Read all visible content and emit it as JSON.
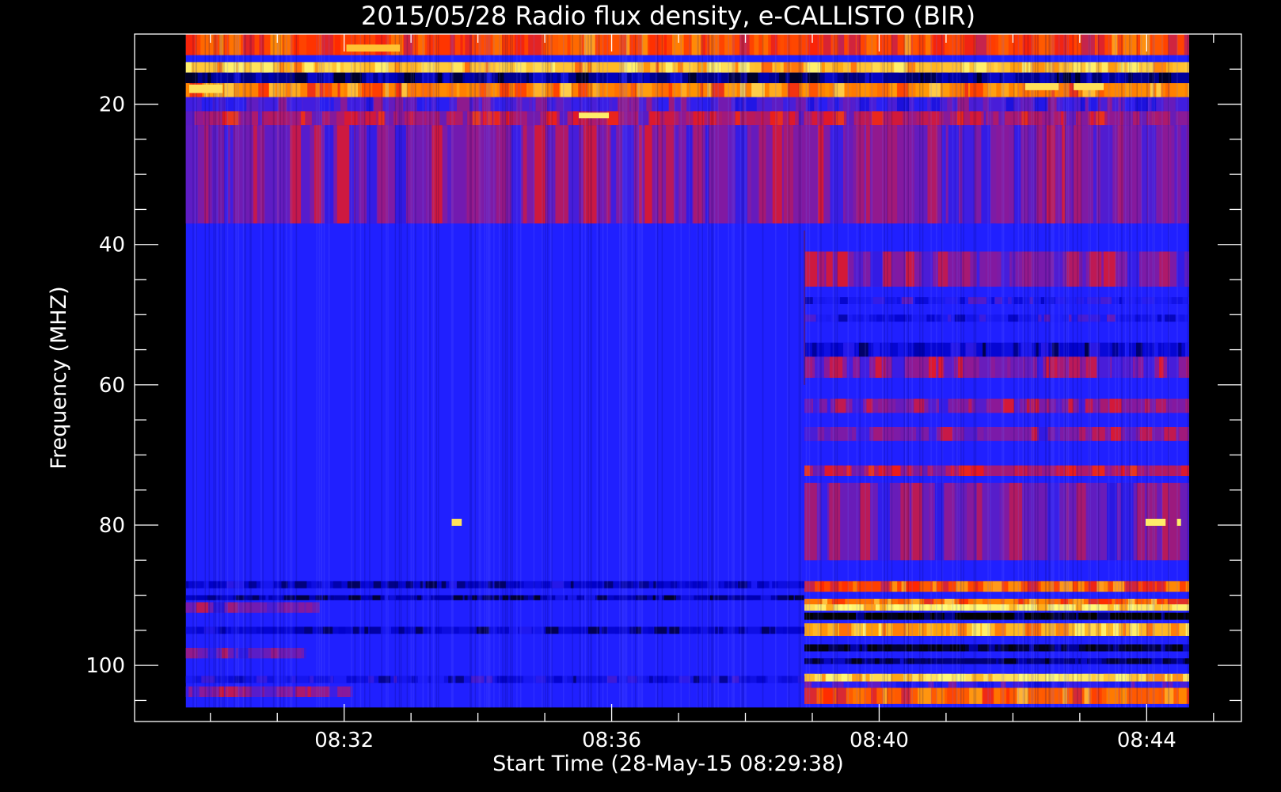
{
  "chart_data": {
    "type": "heatmap",
    "title": "2015/05/28  Radio flux density, e-CALLISTO (BIR)",
    "xlabel": "Start Time (28-May-15 08:29:38)",
    "ylabel": "Frequency (MHZ)",
    "x_tick_labels": [
      "08:32",
      "08:36",
      "08:40",
      "08:44"
    ],
    "x_tick_values_min": [
      2.3667,
      6.3667,
      10.3667,
      14.3667
    ],
    "x_range_min": [
      -0.7667,
      15.7833
    ],
    "data_range_min": [
      0.0,
      15.0
    ],
    "y_tick_labels": [
      "20",
      "40",
      "60",
      "80",
      "100"
    ],
    "y_tick_values": [
      20,
      40,
      60,
      80,
      100
    ],
    "y_range": [
      10,
      108
    ],
    "y_data_range": [
      10,
      106
    ],
    "y_inverted": true,
    "colormap": [
      "#000000",
      "#0000c8",
      "#2020ff",
      "#8a1a9a",
      "#ff1a00",
      "#ff9a00",
      "#ffff80"
    ],
    "background_color": "#2020ff",
    "switch_time_min": 9.25,
    "bands": [
      {
        "f_low": 10,
        "f_high": 13,
        "t_start": 0,
        "t_end": 15,
        "level": 0.72
      },
      {
        "f_low": 14,
        "f_high": 15.5,
        "t_start": 0,
        "t_end": 15,
        "level": 0.9
      },
      {
        "f_low": 15.5,
        "f_high": 17,
        "t_start": 0,
        "t_end": 15,
        "level": 0.12
      },
      {
        "f_low": 17,
        "f_high": 19,
        "t_start": 0,
        "t_end": 15,
        "level": 0.8
      },
      {
        "f_low": 19,
        "f_high": 21,
        "t_start": 0,
        "t_end": 15,
        "level": 0.4
      },
      {
        "f_low": 21,
        "f_high": 23,
        "t_start": 0,
        "t_end": 15,
        "level": 0.55
      },
      {
        "f_low": 23,
        "f_high": 37,
        "t_start": 0,
        "t_end": 15,
        "level": 0.48
      },
      {
        "f_low": 41,
        "f_high": 46,
        "t_start": 9.25,
        "t_end": 15,
        "level": 0.48
      },
      {
        "f_low": 47.5,
        "f_high": 48.5,
        "t_start": 9.25,
        "t_end": 15,
        "level": 0.3
      },
      {
        "f_low": 50,
        "f_high": 51,
        "t_start": 9.25,
        "t_end": 15,
        "level": 0.3
      },
      {
        "f_low": 54,
        "f_high": 56,
        "t_start": 9.25,
        "t_end": 15,
        "level": 0.2
      },
      {
        "f_low": 56,
        "f_high": 59,
        "t_start": 9.25,
        "t_end": 15,
        "level": 0.5
      },
      {
        "f_low": 62,
        "f_high": 64,
        "t_start": 9.25,
        "t_end": 15,
        "level": 0.48
      },
      {
        "f_low": 66,
        "f_high": 68,
        "t_start": 9.25,
        "t_end": 15,
        "level": 0.48
      },
      {
        "f_low": 71.5,
        "f_high": 73,
        "t_start": 9.25,
        "t_end": 15,
        "level": 0.55
      },
      {
        "f_low": 74,
        "f_high": 85,
        "t_start": 9.25,
        "t_end": 15,
        "level": 0.45
      },
      {
        "f_low": 88,
        "f_high": 89.5,
        "t_start": 9.25,
        "t_end": 15,
        "level": 0.72
      },
      {
        "f_low": 90.5,
        "f_high": 91.3,
        "t_start": 9.25,
        "t_end": 15,
        "level": 0.78
      },
      {
        "f_low": 91.3,
        "f_high": 92.2,
        "t_start": 9.25,
        "t_end": 15,
        "level": 0.97
      },
      {
        "f_low": 92.5,
        "f_high": 93.5,
        "t_start": 9.25,
        "t_end": 15,
        "level": 0.0
      },
      {
        "f_low": 94,
        "f_high": 95.8,
        "t_start": 9.25,
        "t_end": 15,
        "level": 0.88
      },
      {
        "f_low": 97,
        "f_high": 98,
        "t_start": 9.25,
        "t_end": 15,
        "level": 0.05
      },
      {
        "f_low": 99,
        "f_high": 99.8,
        "t_start": 9.25,
        "t_end": 15,
        "level": 0.1
      },
      {
        "f_low": 101.2,
        "f_high": 102.3,
        "t_start": 9.25,
        "t_end": 15,
        "level": 0.95
      },
      {
        "f_low": 102.3,
        "f_high": 103.2,
        "t_start": 9.25,
        "t_end": 15,
        "level": 0.35
      },
      {
        "f_low": 103.2,
        "f_high": 105.5,
        "t_start": 9.25,
        "t_end": 15,
        "level": 0.75
      },
      {
        "f_low": 88,
        "f_high": 89,
        "t_start": 0,
        "t_end": 9.25,
        "level": 0.2
      },
      {
        "f_low": 90,
        "f_high": 90.7,
        "t_start": 0,
        "t_end": 9.25,
        "level": 0.15
      },
      {
        "f_low": 91,
        "f_high": 92.5,
        "t_start": 0,
        "t_end": 2.0,
        "level": 0.45
      },
      {
        "f_low": 94.5,
        "f_high": 95.5,
        "t_start": 0,
        "t_end": 9.25,
        "level": 0.2
      },
      {
        "f_low": 97.5,
        "f_high": 99,
        "t_start": 0,
        "t_end": 1.8,
        "level": 0.45
      },
      {
        "f_low": 101.5,
        "f_high": 102.5,
        "t_start": 0,
        "t_end": 9.25,
        "level": 0.25
      },
      {
        "f_low": 103,
        "f_high": 104.5,
        "t_start": 0,
        "t_end": 2.5,
        "level": 0.5
      }
    ],
    "spots": [
      {
        "t": 4.05,
        "f": 79.6,
        "w": 0.15,
        "h": 1.0,
        "level": 0.95
      },
      {
        "t": 6.1,
        "f": 21.6,
        "w": 0.45,
        "h": 0.8,
        "level": 0.97
      },
      {
        "t": 14.5,
        "f": 79.6,
        "w": 0.3,
        "h": 1.0,
        "level": 0.97
      },
      {
        "t": 14.85,
        "f": 79.6,
        "w": 0.06,
        "h": 1.0,
        "level": 0.97
      },
      {
        "t": 12.8,
        "f": 17.5,
        "w": 0.5,
        "h": 1.0,
        "level": 0.95
      },
      {
        "t": 13.5,
        "f": 17.5,
        "w": 0.45,
        "h": 1.0,
        "level": 0.95
      },
      {
        "t": 0.3,
        "f": 17.8,
        "w": 0.5,
        "h": 1.2,
        "level": 0.95
      },
      {
        "t": 2.8,
        "f": 12.0,
        "w": 0.8,
        "h": 1.0,
        "level": 0.9
      }
    ]
  }
}
